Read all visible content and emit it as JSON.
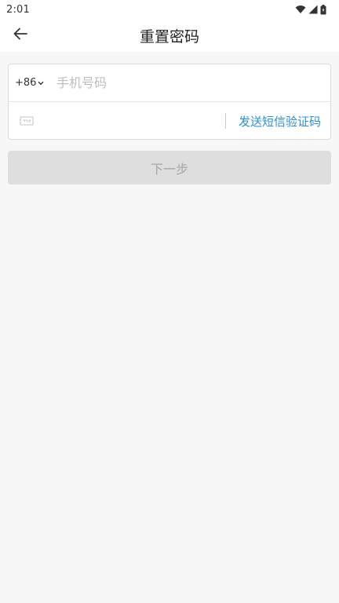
{
  "status_bar": {
    "time": "2:01",
    "icons": [
      "wifi-icon",
      "signal-icon",
      "battery-icon"
    ]
  },
  "app_bar": {
    "title": "重置密码",
    "back_icon": "arrow-left-icon"
  },
  "form": {
    "country_code": "+86",
    "phone_placeholder": "手机号码",
    "phone_value": "",
    "code_value": "",
    "code_icon": "sms-code-icon",
    "send_code_label": "发送短信验证码"
  },
  "next_button": {
    "label": "下一步",
    "enabled": false
  },
  "colors": {
    "accent": "#2a8fd8",
    "background": "#f7f7f7",
    "disabled_button": "#dedede"
  }
}
